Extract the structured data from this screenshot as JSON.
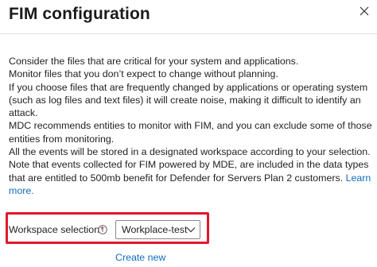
{
  "header": {
    "title": "FIM configuration"
  },
  "icons": {
    "close": "close-icon",
    "info": "info-icon",
    "dropdown": "chevron-down-icon"
  },
  "description": {
    "lines": [
      "Consider the files that are critical for your system and applications.",
      "Monitor files that you don’t expect to change without planning.",
      "If you choose files that are frequently changed by applications or operating system",
      "(such as log files and text files) it will create noise, making it difficult to identify an",
      "attack.",
      "MDC recommends entities to monitor with FIM, and you can exclude some of those",
      "entities from monitoring.",
      "All the events will be stored in a designated workspace according to your selection.",
      "Note that events collected for FIM powered by MDE, are included in the data types",
      "that are entitled to 500mb benefit for Defender for Servers Plan 2 customers."
    ],
    "learn_more_part1": "Learn",
    "learn_more_part2": "more."
  },
  "workspace": {
    "label": "Workspace selection",
    "required_marker": "*",
    "selected_value": "Workplace-test",
    "create_new_label": "Create new"
  },
  "colors": {
    "link": "#0f6cbd",
    "highlight": "#e0182b",
    "required": "#a4262c"
  }
}
